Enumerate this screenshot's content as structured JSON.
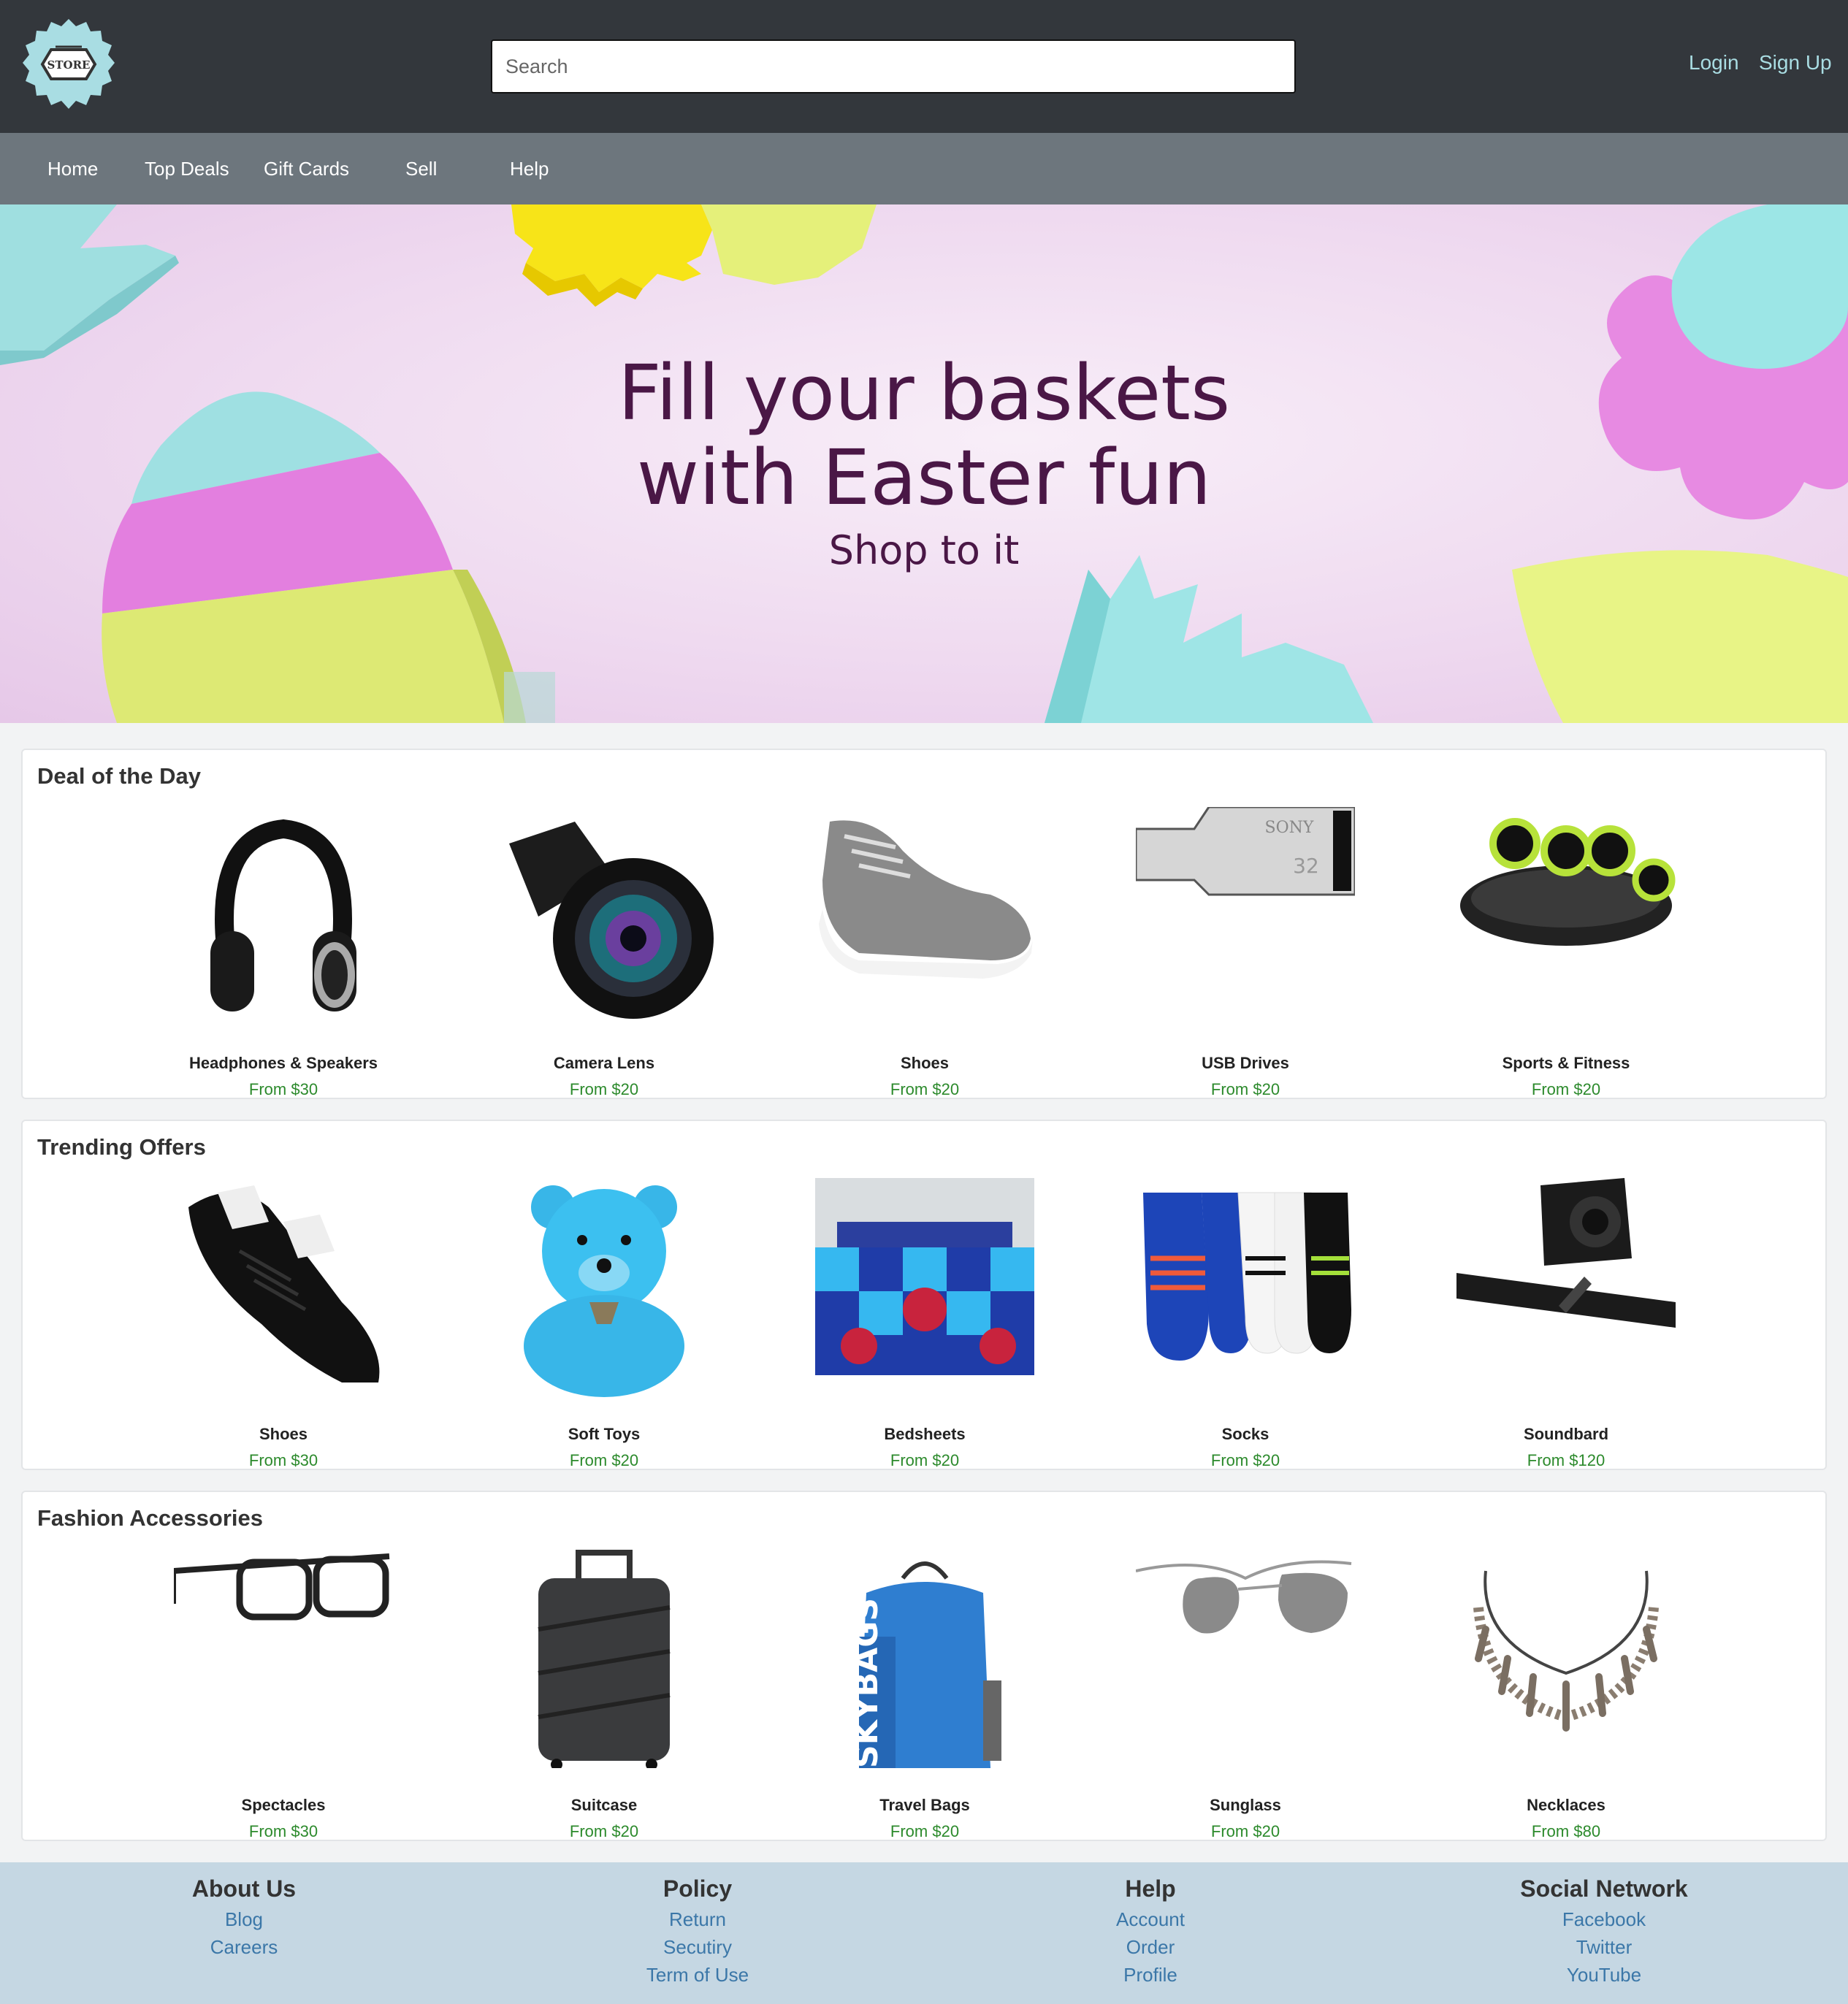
{
  "header": {
    "logo_text": "STORE",
    "search_placeholder": "Search",
    "login_label": "Login",
    "signup_label": "Sign Up"
  },
  "nav": {
    "items": [
      "Home",
      "Top Deals",
      "Gift Cards",
      "Sell",
      "Help"
    ]
  },
  "hero": {
    "title_line1": "Fill your baskets",
    "title_line2": "with Easter fun",
    "subtitle": "Shop to it"
  },
  "sections": [
    {
      "title": "Deal of the Day",
      "items": [
        {
          "name": "Headphones & Speakers",
          "price": "From $30",
          "icon": "headphones-icon"
        },
        {
          "name": "Camera Lens",
          "price": "From $20",
          "icon": "camera-lens-icon"
        },
        {
          "name": "Shoes",
          "price": "From $20",
          "icon": "sneaker-icon"
        },
        {
          "name": "USB Drives",
          "price": "From $20",
          "icon": "usb-drive-icon",
          "brand": "SONY",
          "capacity": "32"
        },
        {
          "name": "Sports & Fitness",
          "price": "From $20",
          "icon": "ab-roller-icon"
        }
      ]
    },
    {
      "title": "Trending Offers",
      "items": [
        {
          "name": "Shoes",
          "price": "From $30",
          "icon": "black-sneaker-icon"
        },
        {
          "name": "Soft Toys",
          "price": "From $20",
          "icon": "teddy-bear-icon"
        },
        {
          "name": "Bedsheets",
          "price": "From $20",
          "icon": "bedsheet-icon"
        },
        {
          "name": "Socks",
          "price": "From $20",
          "icon": "socks-icon"
        },
        {
          "name": "Soundbard",
          "price": "From $120",
          "icon": "soundbar-icon"
        }
      ]
    },
    {
      "title": "Fashion Accessories",
      "items": [
        {
          "name": "Spectacles",
          "price": "From $30",
          "icon": "spectacles-icon"
        },
        {
          "name": "Suitcase",
          "price": "From $20",
          "icon": "suitcase-icon"
        },
        {
          "name": "Travel Bags",
          "price": "From $20",
          "icon": "backpack-icon"
        },
        {
          "name": "Sunglass",
          "price": "From $20",
          "icon": "sunglasses-icon"
        },
        {
          "name": "Necklaces",
          "price": "From $80",
          "icon": "necklace-icon"
        }
      ]
    }
  ],
  "footer": {
    "columns": [
      {
        "title": "About Us",
        "links": [
          "Blog",
          "Careers"
        ]
      },
      {
        "title": "Policy",
        "links": [
          "Return",
          "Secutiry",
          "Term of Use"
        ]
      },
      {
        "title": "Help",
        "links": [
          "Account",
          "Order",
          "Profile"
        ]
      },
      {
        "title": "Social Network",
        "links": [
          "Facebook",
          "Twitter",
          "YouTube"
        ]
      }
    ]
  },
  "colors": {
    "header_bg": "#33373c",
    "nav_bg": "#6d767d",
    "link": "#a9dde3",
    "price": "#2c8a2c",
    "footer_bg": "#c5d7e3",
    "hero_text": "#4a1746"
  }
}
